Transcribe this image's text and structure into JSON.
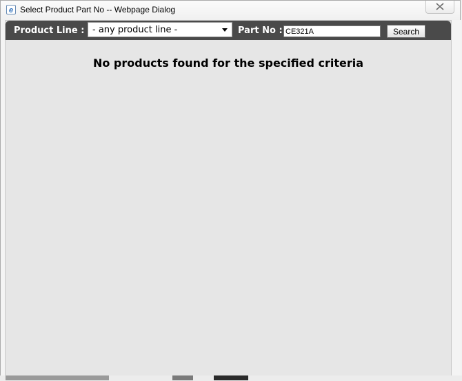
{
  "window": {
    "title": "Select Product Part No -- Webpage Dialog",
    "app_icon_glyph": "e",
    "icons": {
      "app": "ie-page-icon",
      "close": "close-icon"
    }
  },
  "search_bar": {
    "product_line_label": "Product Line :",
    "product_line_selected": "- any product line -",
    "part_no_label": "Part No :",
    "part_no_value": "CE321A",
    "search_button_label": "Search"
  },
  "results": {
    "message": "No products found for the specified criteria"
  },
  "colors": {
    "search_bar_bg": "#4a4a4a",
    "content_bg": "#e6e6e6",
    "label_text": "#ffffff"
  }
}
